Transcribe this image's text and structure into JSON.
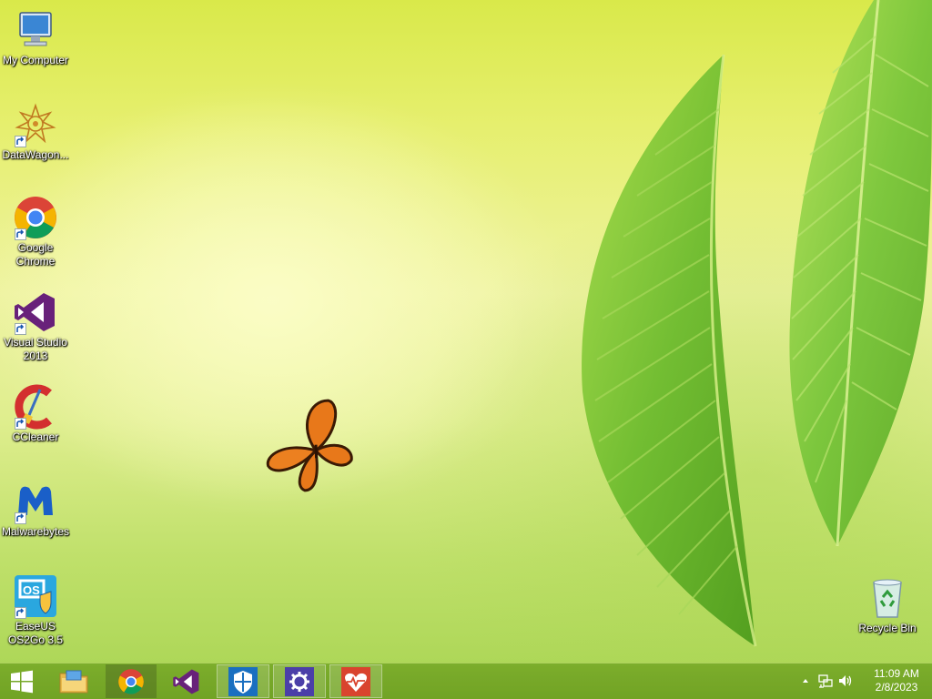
{
  "desktop": {
    "icons": [
      {
        "label": "My Computer",
        "icon": "computer-icon"
      },
      {
        "label": "DataWagon...",
        "icon": "datawagon-icon"
      },
      {
        "label": "Google\nChrome",
        "icon": "chrome-icon"
      },
      {
        "label": "Visual Studio\n2013",
        "icon": "visual-studio-icon"
      },
      {
        "label": "CCleaner",
        "icon": "ccleaner-icon"
      },
      {
        "label": "Malwarebytes",
        "icon": "malwarebytes-icon"
      },
      {
        "label": "EaseUS\nOS2Go 3.5",
        "icon": "easeus-os2go-icon"
      },
      {
        "label": "Recycle Bin",
        "icon": "recycle-bin-icon"
      }
    ]
  },
  "taskbar": {
    "start": {
      "icon": "windows-logo-icon"
    },
    "pinned": [
      {
        "name": "File Explorer",
        "icon": "file-explorer-icon"
      },
      {
        "name": "Google Chrome",
        "icon": "chrome-icon"
      },
      {
        "name": "Visual Studio",
        "icon": "visual-studio-icon"
      },
      {
        "name": "Windows Defender",
        "icon": "shield-icon"
      },
      {
        "name": "Settings",
        "icon": "gear-icon"
      },
      {
        "name": "Health Monitor",
        "icon": "heart-pulse-icon"
      }
    ],
    "tray": {
      "icons": [
        "chevron-up-icon",
        "network-icon",
        "speaker-icon"
      ],
      "time": "11:09 AM",
      "date": "2/8/2023"
    }
  },
  "colors": {
    "taskbar": "#78aa28",
    "wallpaper_top": "#d9e94a",
    "wallpaper_bottom": "#a8d452",
    "leaf": "#7cc43a"
  }
}
